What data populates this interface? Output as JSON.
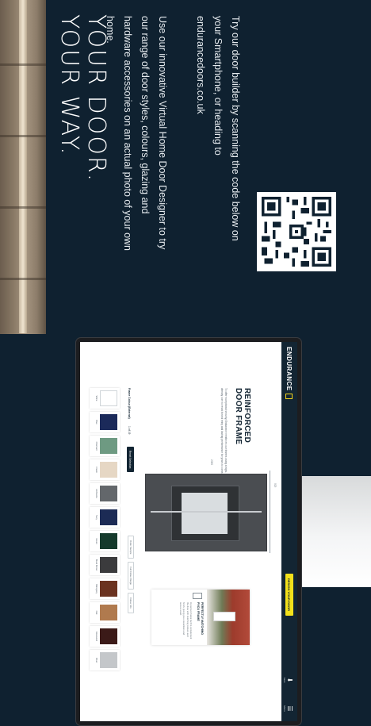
{
  "headline": [
    "YOUR DOOR.",
    "YOUR WAY."
  ],
  "paragraphs": [
    "Use our innovative Virtual Home Door Designer to try our range of door styles, colours, glazing and hardware accessories on an actual photo of your own home.",
    "Try our door builder by scanning the code below on your Smartphone, or heading to endurancedoors.co.uk"
  ],
  "app": {
    "logo": "ENDURANCE",
    "design_button": "DESIGN YOUR DOOR",
    "icons": [
      {
        "name": "Save",
        "icon": "save-icon"
      },
      {
        "name": "Menu",
        "icon": "menu-icon"
      }
    ],
    "feature_title": [
      "REINFORCED",
      "DOOR FRAME"
    ],
    "feature_desc": "To offer exceptional security, Endurance reinforces our frames using a high-density core to resist forced entry and lasting performance for years to come.",
    "dimension_width": "925",
    "dimension_height": "2080",
    "info_title": "PERFECTLY MATCHING PVCU FRAME",
    "info_text": "A premium frame built to complement the door with matching colours and finish, giving you a seamless and secure result.",
    "swatch_heading": "Frame Colour (External)",
    "swatch_count": "1 of 19",
    "reset_label": "Reset Selection",
    "filters": [
      "Order Sample",
      "Full Colour Range",
      "Colour Info"
    ],
    "swatches": [
      {
        "name": "White",
        "color": "#ffffff"
      },
      {
        "name": "Blue",
        "color": "#1b2a5a"
      },
      {
        "name": "Chartwell",
        "color": "#6e9a82"
      },
      {
        "name": "Cream",
        "color": "#e6d7c4"
      },
      {
        "name": "Anthracite",
        "color": "#63676b"
      },
      {
        "name": "Navy",
        "color": "#1c2b55"
      },
      {
        "name": "Green",
        "color": "#153a2c"
      },
      {
        "name": "Black Brown",
        "color": "#3b3b3d"
      },
      {
        "name": "Mahogany",
        "color": "#6b3320"
      },
      {
        "name": "Oak",
        "color": "#b07a4e"
      },
      {
        "name": "Rosewood",
        "color": "#3b1a18"
      },
      {
        "name": "Silver",
        "color": "#c4c7ca"
      }
    ]
  }
}
